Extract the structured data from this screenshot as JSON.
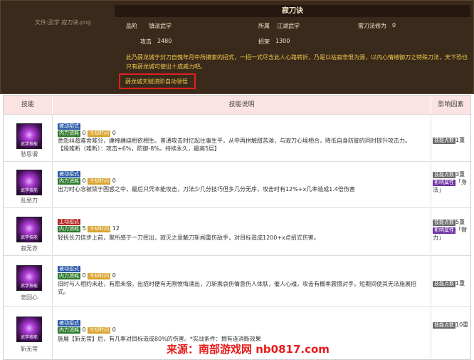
{
  "header": {
    "title": "寂刀诀",
    "image_name": "文件:武学 寂刀诀.png",
    "stats": {
      "rank_label": "品阶",
      "rank_value": "镇派武学",
      "school_label": "所属",
      "school_value": "江湖武学",
      "req_label": "需刀法修为",
      "req_value": "0",
      "atk_label": "攻击",
      "atk_value": "2480",
      "parry_label": "招架",
      "parry_value": "1300"
    },
    "description": "此乃薛龙城于封刀自愧年月中所摸索的招式，一招一式尽含此人心路转折，乃是以枯寂悲恨为源，以内心情绪御刀之特殊刀法，天下恐也只有薛龙城可使出十成威力吧。",
    "talent_text": "薛龙城天赋进阶自动领悟"
  },
  "table": {
    "headers": {
      "skill": "技能",
      "desc": "技能说明",
      "influence": "影响因素"
    },
    "rows": [
      {
        "name": "愁思谓",
        "icon_text": "武学技能",
        "type_tag": "被动招式",
        "cost_tag": "内力消耗",
        "cost": "0",
        "cd_tag": "冷却时间",
        "cd": "0",
        "desc": "悉怨纠葛难舍难分，缠绵缠绕相依相生。普通攻击时忆起往事生平，从中再拼触甜苦滩，与寂刀心境相合，降低自身防御的同时提升攻击力。【缘难断（难断）：攻击+6%，防御-8%。持续永久，最高5层】",
        "influence": [
          {
            "tag": "技能点数",
            "text": "1重"
          }
        ]
      },
      {
        "name": "乱愁刀",
        "icon_text": "武学技能",
        "type_tag": "被动招式",
        "cost_tag": "内力消耗",
        "cost": "0",
        "cd_tag": "冷却时间",
        "cd": "0",
        "desc": "出刀时心念被锁于困惑之中，最后只凭本能攻击，刀法少几分技巧但多几分无序，攻击时有12%+x几率造成1.4倍伤害",
        "influence": [
          {
            "tag": "技能点数",
            "text": "3重"
          },
          {
            "tag": "影响属性",
            "text": "「身法」"
          }
        ]
      },
      {
        "name": "寂无亦",
        "icon_text": "武学技能",
        "type_tag": "主动招式",
        "cost_tag": "内力消耗",
        "cost": "5",
        "cd_tag": "冷却时间",
        "cd": "12",
        "desc": "轻抚长刀信步上前，聚所感于一刀挥出，寂灭之意触刀斩闻重伤敌手，对目标造成1200+x点招式伤害。",
        "influence": [
          {
            "tag": "技能点数",
            "text": "5重"
          },
          {
            "tag": "影响属性",
            "text": "「臂力」"
          }
        ]
      },
      {
        "name": "悲回心",
        "icon_text": "武学技能",
        "type_tag": "被动招式",
        "cost_tag": "内力消耗",
        "cost": "0",
        "cd_tag": "冷却时间",
        "cd": "0",
        "desc": "旧时与人相约未赴，有愿未偿，出招时便有无限愤悔涌出，刀斩携哀伤情意伤人体肤，催人心魂，攻击有概率震慑对手，短期间使其无法施展招式。",
        "influence": [
          {
            "tag": "技能点数",
            "text": "1重"
          }
        ]
      },
      {
        "name": "斩无常",
        "icon_text": "武学技能",
        "type_tag": "被动招式",
        "cost_tag": "内力消耗",
        "cost": "0",
        "cd_tag": "冷却时间",
        "cd": "0",
        "desc": "施展【斩无常】后，有几率对目标造成80%的伤害。*实战条件：拥有连消断效果",
        "influence": [
          {
            "tag": "技能点数",
            "text": "10重"
          }
        ]
      }
    ]
  },
  "watermark": "来源：南部游戏网 nb0817.com"
}
